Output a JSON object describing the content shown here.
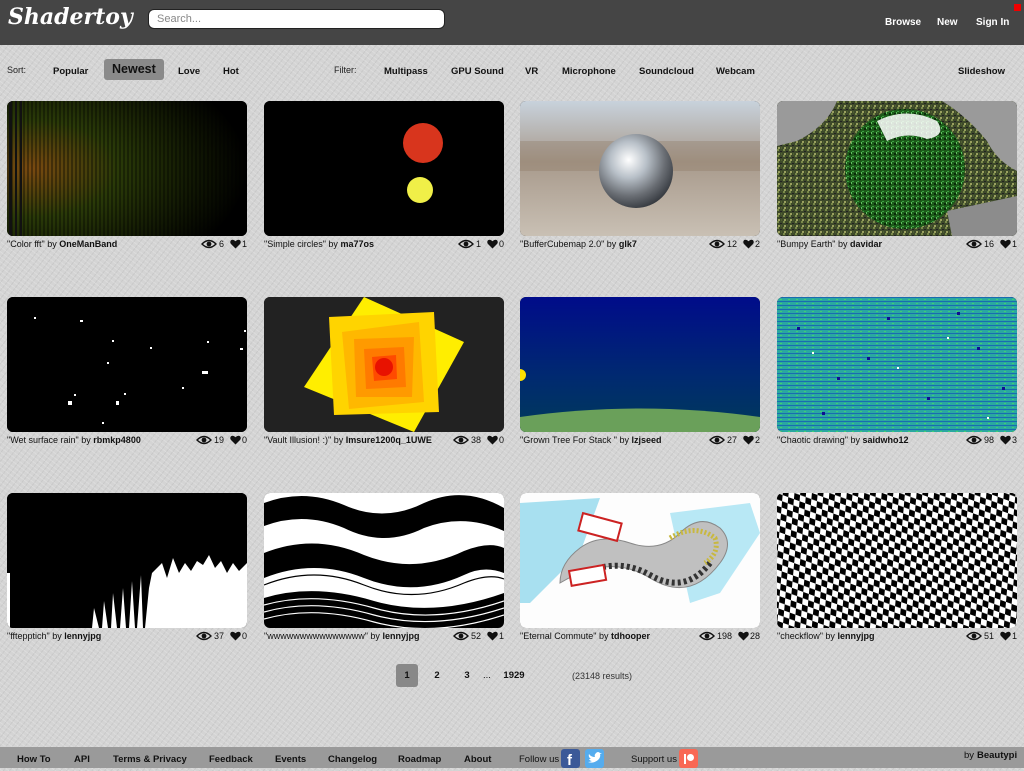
{
  "header": {
    "logo": "Shadertoy",
    "search_placeholder": "Search...",
    "links": [
      "Browse",
      "New",
      "Sign In"
    ]
  },
  "sort": {
    "label": "Sort:",
    "options": [
      "Popular",
      "Newest",
      "Love",
      "Hot"
    ],
    "active": "Newest"
  },
  "filter": {
    "label": "Filter:",
    "options": [
      "Multipass",
      "GPU Sound",
      "VR",
      "Microphone",
      "Soundcloud",
      "Webcam"
    ]
  },
  "slideshow_label": "Slideshow",
  "by_label": "by",
  "shaders": [
    {
      "title": "\"Color fft\"",
      "author": "OneManBand",
      "views": "6",
      "likes": "1"
    },
    {
      "title": "\"Simple circles\"",
      "author": "ma77os",
      "views": "1",
      "likes": "0"
    },
    {
      "title": "\"BufferCubemap 2.0\"",
      "author": "glk7",
      "views": "12",
      "likes": "2"
    },
    {
      "title": "\"Bumpy Earth\"",
      "author": "davidar",
      "views": "16",
      "likes": "1"
    },
    {
      "title": "\"Wet surface rain\"",
      "author": "rbmkp4800",
      "views": "19",
      "likes": "0"
    },
    {
      "title": "\"Vault Illusion! :)\"",
      "author": "Imsure1200q_1UWE",
      "views": "38",
      "likes": "0"
    },
    {
      "title": "\"Grown Tree For Stack \"",
      "author": "lzjseed",
      "views": "27",
      "likes": "2"
    },
    {
      "title": "\"Chaotic drawing\"",
      "author": "saidwho12",
      "views": "98",
      "likes": "3"
    },
    {
      "title": "\"fftepptich\"",
      "author": "lennyjpg",
      "views": "37",
      "likes": "0"
    },
    {
      "title": "\"wwwwwwwwwwwwwww\"",
      "author": "lennyjpg",
      "views": "52",
      "likes": "1"
    },
    {
      "title": "\"Eternal Commute\"",
      "author": "tdhooper",
      "views": "198",
      "likes": "28"
    },
    {
      "title": "\"checkflow\"",
      "author": "lennyjpg",
      "views": "51",
      "likes": "1"
    }
  ],
  "pagination": {
    "current": "1",
    "pages": [
      "2",
      "3"
    ],
    "ellipsis": "...",
    "last": "1929",
    "results": "(23148 results)"
  },
  "footer": {
    "links": [
      "How To",
      "API",
      "Terms & Privacy",
      "Feedback",
      "Events",
      "Changelog",
      "Roadmap",
      "About"
    ],
    "follow_label": "Follow us",
    "support_label": "Support us",
    "credit_prefix": "by",
    "credit_name": "Beautypi"
  },
  "colors": {
    "topbar": "#454545",
    "footer": "#9a9a9a",
    "facebook": "#3b5998",
    "twitter": "#55acee",
    "patreon": "#f96854"
  }
}
